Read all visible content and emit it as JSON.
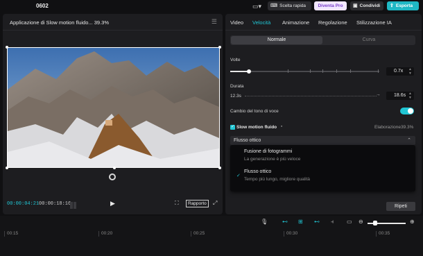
{
  "topbar": {
    "title": "0602",
    "layout_icon": "layout-icon",
    "scelta_label": "Scelta rapida",
    "pro_label": "Diventa Pro",
    "condividi_label": "Condividi",
    "esporta_label": "Esporta",
    "colors": {
      "accent": "#1fb8c4",
      "pro_bg": "#f2e7ff",
      "pro_text": "#7a3fc9"
    }
  },
  "player": {
    "title": "Applicazione di Slow motion fluido... 39.3%",
    "timecode_current": "00:00:04:21",
    "timecode_total": "00:00:18:16",
    "ratio_label": "Rapporto"
  },
  "panel": {
    "tabs": [
      {
        "label": "Video",
        "active": false
      },
      {
        "label": "Velocità",
        "active": true
      },
      {
        "label": "Animazione",
        "active": false
      },
      {
        "label": "Regolazione",
        "active": false
      },
      {
        "label": "Stilizzazione IA",
        "active": false
      }
    ],
    "mode": {
      "normal_label": "Normale",
      "curve_label": "Curva"
    },
    "speed": {
      "label": "Volte",
      "value": "0.7x"
    },
    "duration": {
      "label": "Durata",
      "original": "12.3s",
      "value": "18.6s"
    },
    "pitch": {
      "label": "Cambio del tono di voce",
      "enabled": true
    },
    "slowmo": {
      "label": "Slow motion fluido",
      "status": "Elaborazione39.3%",
      "enabled": true
    },
    "method": {
      "selected": "Flusso ottico",
      "options": [
        {
          "title": "Fusione di fotogrammi",
          "desc": "La generazione è più veloce",
          "selected": false
        },
        {
          "title": "Flusso ottico",
          "desc": "Tempo più lungo, migliore qualità",
          "selected": true
        }
      ]
    },
    "reset_label": "Ripeti"
  },
  "timeline": {
    "ruler": [
      "00:15",
      "00:20",
      "00:25",
      "00:30",
      "00:35"
    ]
  }
}
